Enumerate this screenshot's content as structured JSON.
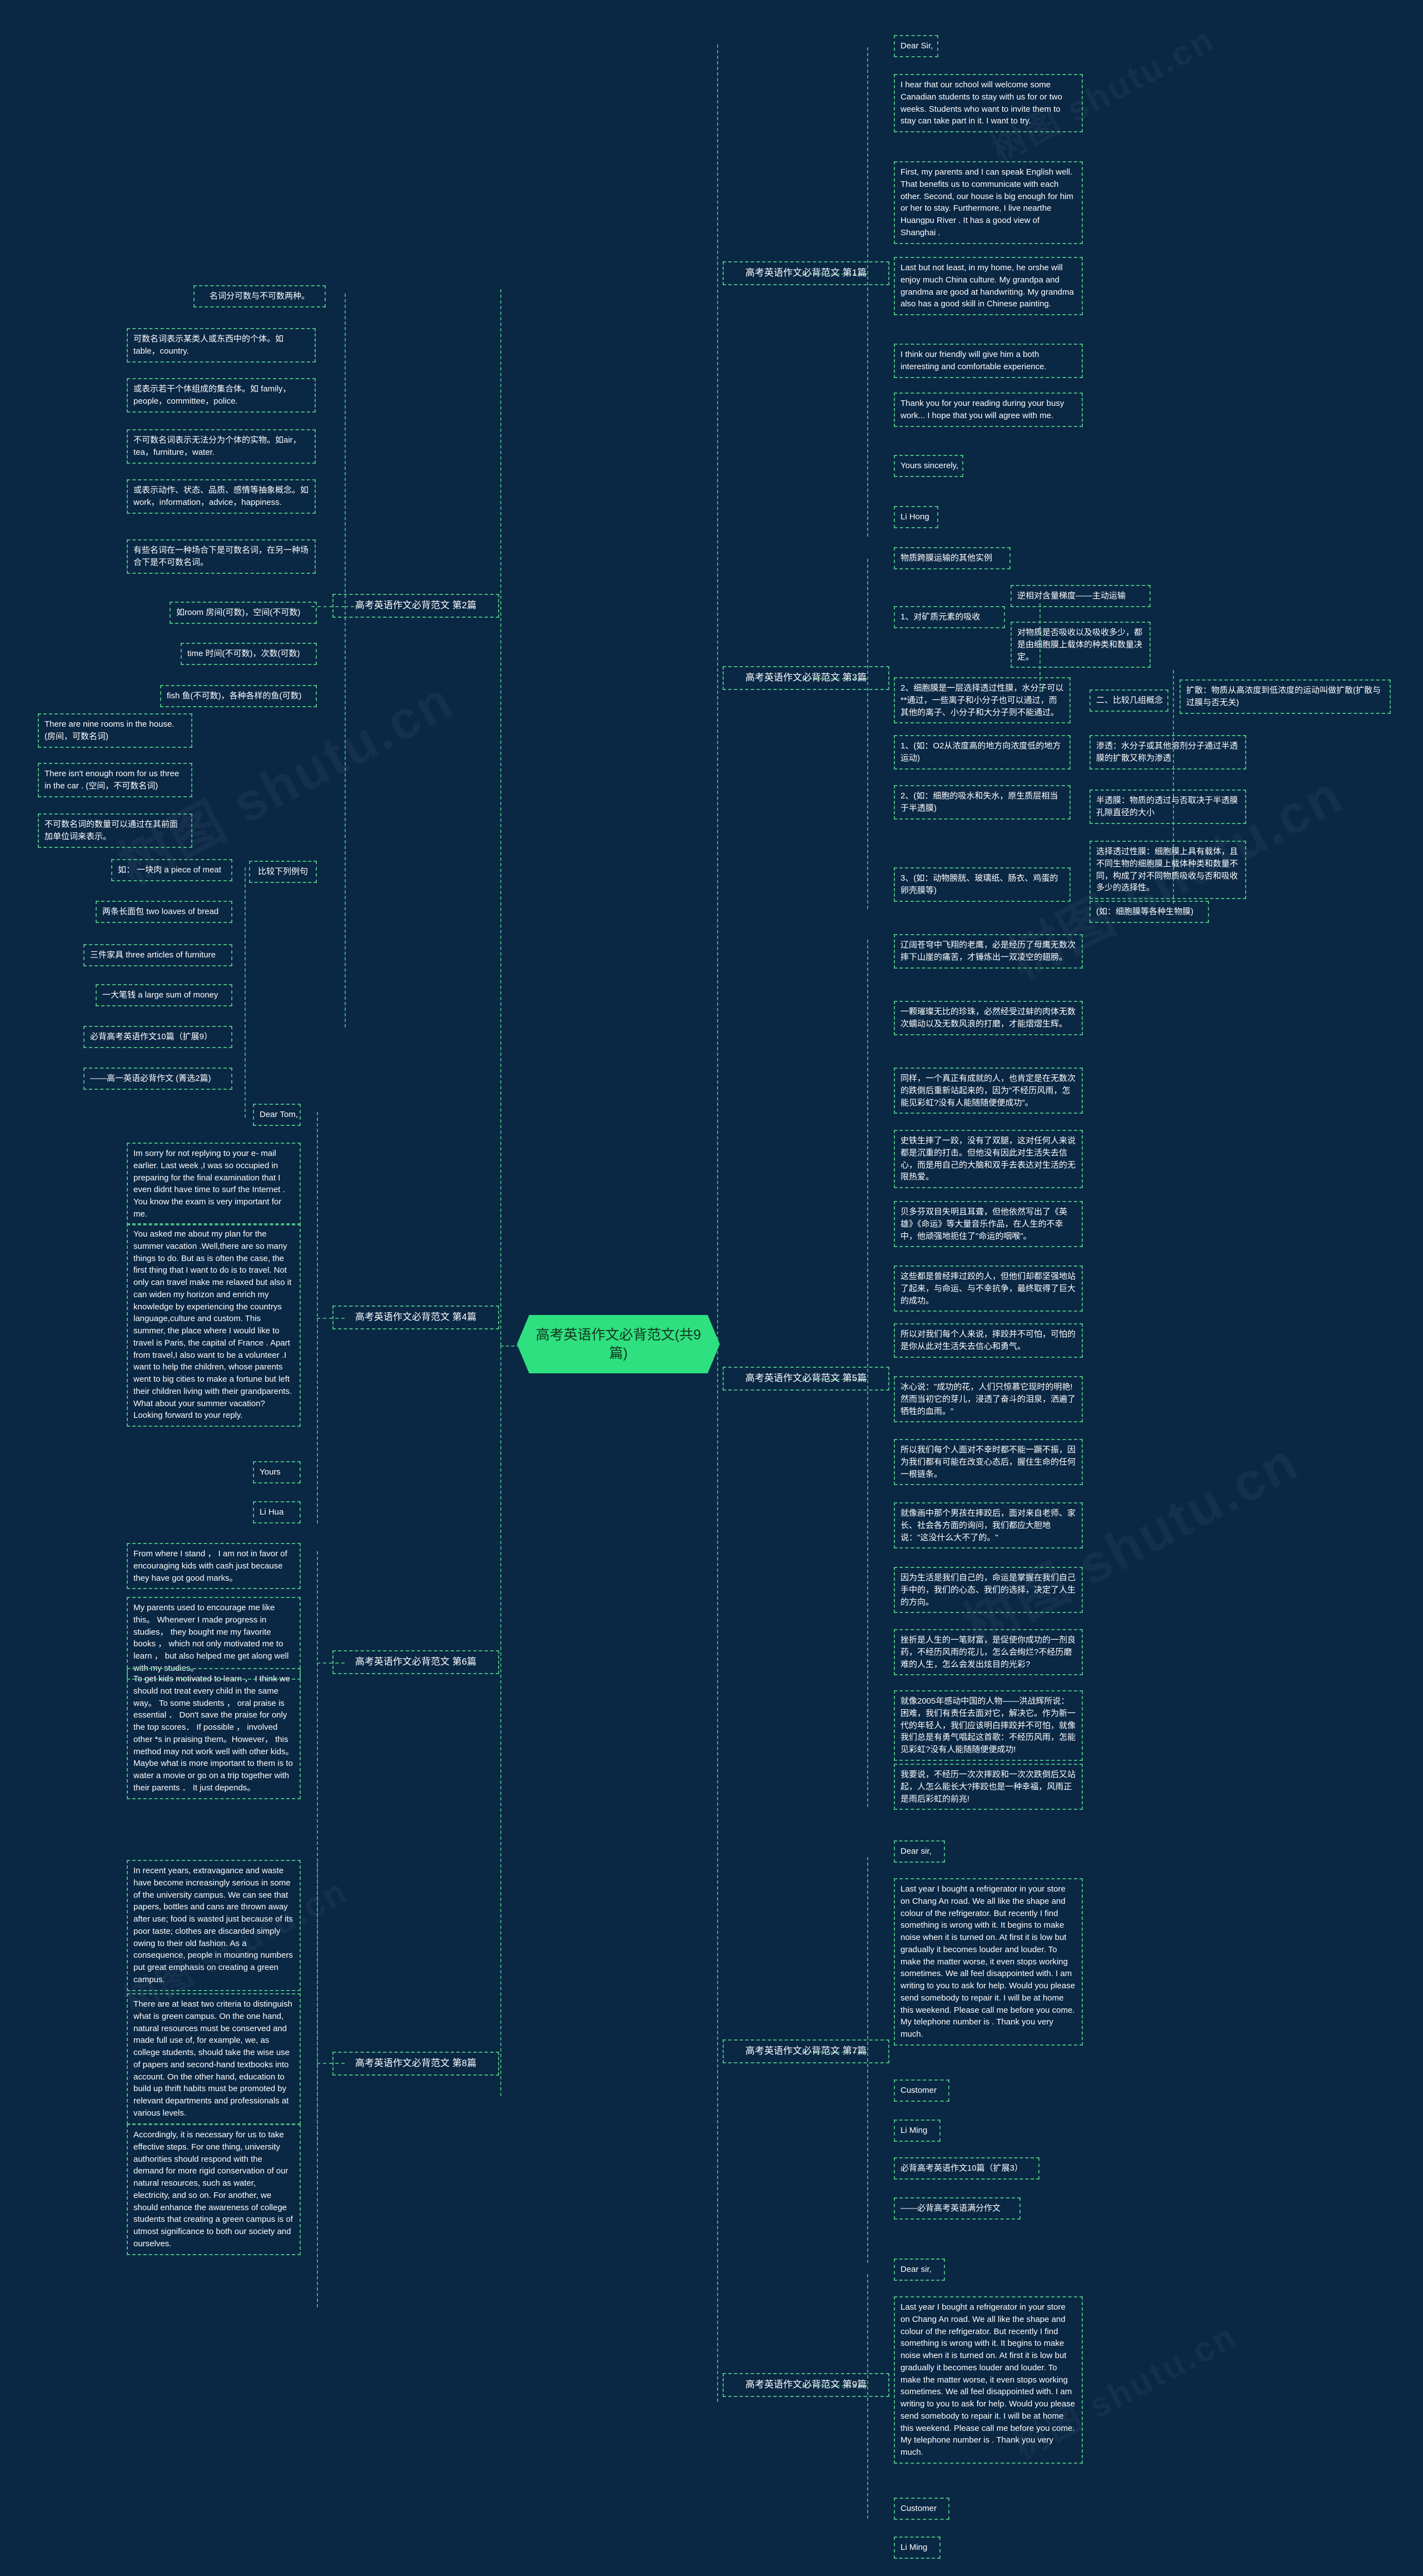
{
  "root": {
    "label": "高考英语作文必背范文(共9篇)",
    "color": "#2ee07f"
  },
  "theme": {
    "bg": "#0a2744",
    "node_border": "#49b97d",
    "text": "#ffffff"
  },
  "watermarks": [
    "树图 shutu.cn",
    "树图 shutu.cn",
    "树图 shutu.cn",
    "树图 shutu.cn",
    "树图 shutu.cn",
    "树图 shutu.cn"
  ],
  "branches": {
    "b2": {
      "label": "高考英语作文必背范文 第2篇",
      "nodes": {
        "n1": "名词分可数与不可数两种。",
        "n2": "可数名词表示某类人或东西中的个体。如table，country.",
        "n3": "或表示若干个体组成的集合体。如 family，people，committee，police.",
        "n4": "不可数名词表示无法分为个体的实物。如air，tea，furniture，water.",
        "n5": "或表示动作、状态、品质、感情等抽象概念。如work，information，advice，happiness.",
        "n6": "有些名词在一种场合下是可数名词，在另一种场合下是不可数名词。",
        "n7": "如room 房间(可数)，空间(不可数)",
        "n8": "time 时间(不可数)，次数(可数)",
        "n9": "fish 鱼(不可数)，各种各样的鱼(可数)",
        "n10": "There are nine rooms in the house. (房间，可数名词)",
        "n11": "There isn't enough room for us three in the car . (空间，不可数名词)",
        "n12": "不可数名词的数量可以通过在其前面加单位词来表示。",
        "n13": "比较下列例句",
        "n14": "如： 一块肉 a piece of meat",
        "n15": "两条长面包 two loaves of bread",
        "n16": "三件家具 three articles of furniture",
        "n17": "一大笔钱 a large sum of money",
        "n18": "必背高考英语作文10篇（扩展9）",
        "n19": "——高一英语必背作文 (菁选2篇)"
      }
    },
    "b1": {
      "label": "高考英语作文必背范文 第1篇",
      "nodes": {
        "n1": "Dear Sir,",
        "n2": "I hear that our school will welcome some Canadian students to stay with us for or two weeks. Students who want to invite them to stay can take part in it. I want to try.",
        "n3": "First, my parents and I can speak English well. That benefits us to communicate with each other. Second, our house is big enough for him or her to stay. Furthermore, I live nearthe Huangpu River . It has a good view of Shanghai .",
        "n4": "Last but not least, in my home, he orshe will enjoy much China culture. My grandpa and grandma are good at handwriting. My grandma also has a good skill in Chinese painting.",
        "n5": "I think our friendly will give him a both interesting and comfortable experience.",
        "n6": "Thank you for your reading during your busy work... I hope that you will agree with me.",
        "n7": "Yours sincerely,",
        "n8": "Li Hong"
      }
    },
    "b3": {
      "label": "高考英语作文必背范文 第3篇",
      "nodes": {
        "n1": "物质跨膜运输的其他实例",
        "n2": "1、对矿质元素的吸收",
        "n3": "逆相对含量梯度——主动运输",
        "n4": "对物质是否吸收以及吸收多少，都是由细胞膜上载体的种类和数量决定。",
        "n5": "2、细胞膜是一层选择透过性膜，水分子可以**通过，一些离子和小分子也可以通过，而其他的离子、小分子和大分子则不能通过。",
        "n6": "二、比较几组概念",
        "n7": "扩散：物质从高浓度到低浓度的运动叫做扩散(扩散与过膜与否无关)",
        "n8": "1、(如：O2从浓度高的地方向浓度低的地方运动)",
        "n9": "渗透：水分子或其他溶剂分子通过半透膜的扩散又称为渗透",
        "n10": "2、(如：细胞的吸水和失水，原生质层相当于半透膜)",
        "n11": "半透膜：物质的透过与否取决于半透膜孔隙直径的大小",
        "n12": "选择透过性膜：细胞膜上具有载体，且不同生物的细胞膜上载体种类和数量不同，构成了对不同物质吸收与否和吸收多少的选择性。",
        "n13": "3、(如：动物膀胱、玻璃纸、肠衣、鸡蛋的卵壳膜等)",
        "n14": "(如：细胞膜等各种生物膜)"
      }
    },
    "b5": {
      "label": "高考英语作文必背范文 第5篇",
      "nodes": {
        "n1": "辽阔苍穹中飞翔的老鹰，必是经历了母鹰无数次摔下山崖的痛苦，才锤炼出一双凌空的翅膀。",
        "n2": "一颗璀璨无比的珍珠，必然经受过蚌的肉体无数次蠕动以及无数风浪的打磨，才能熠熠生辉。",
        "n3": "同样，一个真正有成就的人，也肯定是在无数次的跌倒后重新站起来的，因为\"不经历风雨，怎能见彩虹?没有人能随随便便成功\"。",
        "n4": "史铁生摔了一跤，没有了双腿，这对任何人来说都是沉重的打击。但他没有因此对生活失去信心，而是用自己的大脑和双手去表达对生活的无限热爱。",
        "n5": "贝多芬双目失明且耳聋，但他依然写出了《英雄》《命运》等大量音乐作品，在人生的不幸中，他顽强地扼住了\"命运的咽喉\"。",
        "n6": "这些都是曾经摔过跤的人，但他们却都坚强地站了起来，与命运、与不幸抗争，最终取得了巨大的成功。",
        "n7": "所以对我们每个人来说，摔跤并不可怕，可怕的是你从此对生活失去信心和勇气。",
        "n8": "冰心说：\"成功的花，人们只惊慕它现时的明艳!然而当初它的芽儿，浸透了奋斗的泪泉，洒遍了牺牲的血雨。\"",
        "n9": "所以我们每个人面对不幸时都不能一蹶不振，因为我们都有可能在改变心态后，握住生命的任何一根链条。",
        "n10": "就像画中那个男孩在摔跤后，面对来自老师、家长、社会各方面的询问，我们都应大胆地说：\"这没什么大不了的。\"",
        "n11": "因为生活是我们自己的，命运是掌握在我们自己手中的，我们的心态、我们的选择，决定了人生的方向。",
        "n12": "挫折是人生的一笔财富，是促使你成功的一剂良药，不经历风雨的花儿，怎么会绚烂?不经历磨难的人生，怎么会发出炫目的光彩?",
        "n13": "就像2005年感动中国的人物——洪战辉所说：困难，我们有责任去面对它，解决它。作为新一代的年轻人，我们应该明白摔跤并不可怕，就像我们总是有勇气唱起这首歌：不经历风雨，怎能见彩虹?没有人能随随便便成功!",
        "n14": "我要说，不经历一次次摔跤和一次次跌倒后又站起，人怎么能长大?摔跤也是一种幸福，风雨正是雨后彩虹的前兆!"
      }
    },
    "b4": {
      "label": "高考英语作文必背范文 第4篇",
      "nodes": {
        "n1": "Dear Tom,",
        "n2": "Im sorry for not replying to your e- mail earlier. Last week ,I was so occupied in preparing for the final examination that I even didnt have time to surf the Internet . You know the exam is very important for me.",
        "n3": "You asked me about my plan for the summer vacation .Well,there are so many things to do. But as is often the case, the first thing that I want to do is to travel. Not only can travel make me relaxed but also it can widen my horizon and enrich my knowledge by experiencing the countrys language,culture and custom. This summer, the place where I would like to travel is Paris, the capital of France . Apart from travel,I also want to be a volunteer .I want to help the children, whose parents went to big cities to make a fortune but left their children living with their grandparents. What about your summer vacation? Looking forward to your reply.",
        "n4": "Yours",
        "n5": "Li Hua"
      }
    },
    "b6": {
      "label": "高考英语作文必背范文 第6篇",
      "nodes": {
        "n1": "From where I stand ， I am not in favor of encouraging kids with cash just because they have got good marks。",
        "n2": "My parents used to encourage me like this。 Whenever I made progress in studies， they bought me my favorite books ， which not only motivated me to learn ， but also helped me get along well with my studies。",
        "n3": "To get kids motivated to learn ， I think we should not treat every child in the same way。 To some students ， oral praise is essential ． Don't save the praise for only the top scores． If possible ， involved other *s in praising them。However， this method may not work well with other kids。 Maybe what is more important to them is to water a movie or go on a trip together with their parents ． It just depends。",
        "n4": "In recent years, extravagance and waste have become increasingly serious in some of the university campus. We can see that papers, bottles and cans are thrown away after use; food is wasted just because of its poor taste; clothes are discarded simply owing to their old fashion. As a consequence, people in mounting numbers put great emphasis on creating a green campus.",
        "n5": "There are at least two criteria to distinguish what is green campus. On the one hand, natural resources must be conserved and made full use of, for example, we, as college students, should take the wise use of papers and second-hand textbooks into account. On the other hand, education to build up thrift habits must be promoted by relevant departments and professionals at various levels.",
        "n6": "Accordingly, it is necessary for us to take effective steps. For one thing, university authorities should respond with the demand for more rigid conservation of our natural resources, such as water, electricity, and so on. For another, we should enhance the awareness of college students that creating a green campus is of utmost significance to both our society and ourselves."
      }
    },
    "b8": {
      "label": "高考英语作文必背范文 第8篇"
    },
    "b7": {
      "label": "高考英语作文必背范文 第7篇",
      "nodes": {
        "n1": "Dear sir,",
        "n2": "Last year I bought a refrigerator in your store on Chang An road. We all like the shape and colour of the refrigerator. But recently I find something is wrong with it. It begins to make noise when it is turned on. At first it is low but gradually it becomes louder and louder. To make the matter worse, it even stops working sometimes. We all feel disappointed with. I am writing to you to ask for help. Would you please send somebody to repair it. I will be at home this weekend. Please call me before you come. My telephone number is . Thank you very much.",
        "n3": "Customer",
        "n4": "Li Ming",
        "n5": "必背高考英语作文10篇（扩展3）",
        "n6": "——必背高考英语满分作文"
      }
    },
    "b9": {
      "label": "高考英语作文必背范文 第9篇",
      "nodes": {
        "n1": "Dear sir,",
        "n2": "Last year I bought a refrigerator in your store on Chang An road. We all like the shape and colour of the refrigerator. But recently I find something is wrong with it. It begins to make noise when it is turned on. At first it is low but gradually it becomes louder and louder. To make the matter worse, it even stops working sometimes. We all feel disappointed with. I am writing to you to ask for help. Would you please send somebody to repair it. I will be at home this weekend. Please call me before you come. My telephone number is . Thank you very much.",
        "n3": "Customer",
        "n4": "Li Ming"
      }
    }
  }
}
